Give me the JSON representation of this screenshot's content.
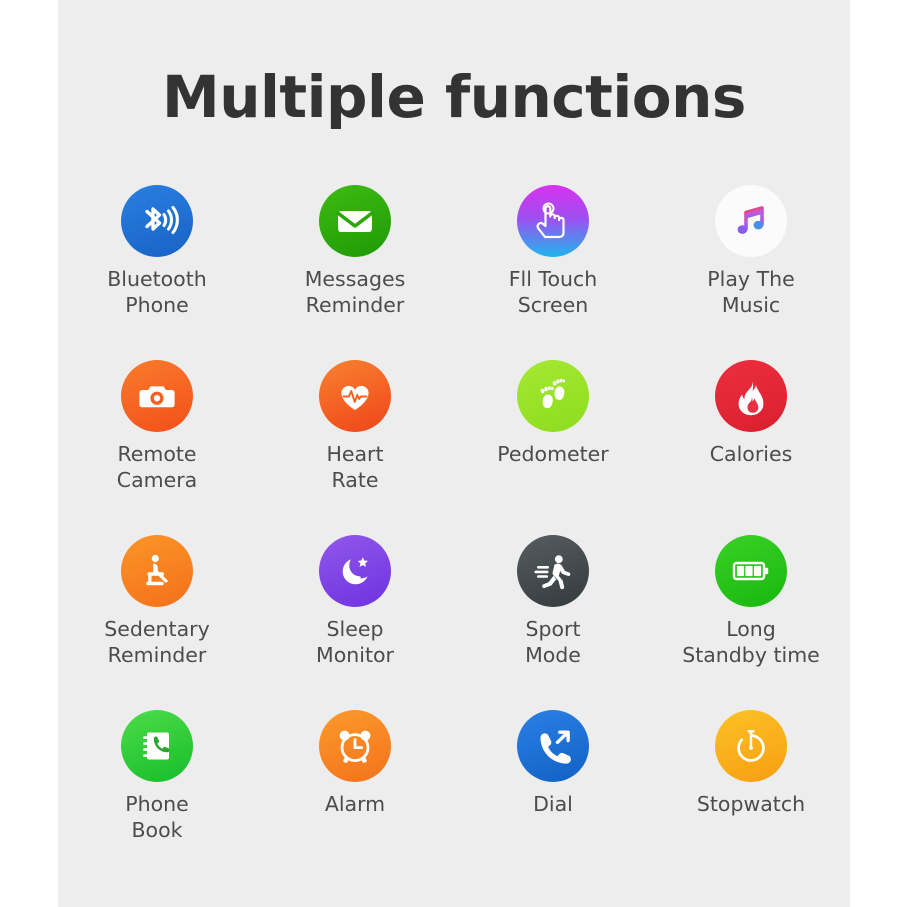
{
  "page": {
    "title": "Multiple functions",
    "background_color": "#ffffff",
    "panel_color": "#ededed",
    "title_color": "#333333",
    "label_color": "#4c4c4c"
  },
  "features": [
    {
      "label": "Bluetooth\nPhone",
      "icon": "bluetooth-icon",
      "accent": "#1862c6"
    },
    {
      "label": "Messages\nReminder",
      "icon": "envelope-icon",
      "accent": "#1f9a05"
    },
    {
      "label": "Fll Touch\nScreen",
      "icon": "touch-hand-icon",
      "accent": "#a04ef0"
    },
    {
      "label": "Play The\nMusic",
      "icon": "music-note-icon",
      "accent": "#f5385c"
    },
    {
      "label": "Remote\nCamera",
      "icon": "camera-icon",
      "accent": "#f24f19"
    },
    {
      "label": "Heart\nRate",
      "icon": "heart-pulse-icon",
      "accent": "#f0441a"
    },
    {
      "label": "Pedometer",
      "icon": "footprints-icon",
      "accent": "#8ddc1f"
    },
    {
      "label": "Calories",
      "icon": "flame-icon",
      "accent": "#d91f2e"
    },
    {
      "label": "Sedentary\nReminder",
      "icon": "seated-person-icon",
      "accent": "#f4701b"
    },
    {
      "label": "Sleep\nMonitor",
      "icon": "moon-star-icon",
      "accent": "#6f32e0"
    },
    {
      "label": "Sport\nMode",
      "icon": "running-person-icon",
      "accent": "#343b3e"
    },
    {
      "label": "Long\nStandby time",
      "icon": "battery-full-icon",
      "accent": "#18b80c"
    },
    {
      "label": "Phone\nBook",
      "icon": "phone-book-icon",
      "accent": "#17bd2a"
    },
    {
      "label": "Alarm",
      "icon": "alarm-clock-icon",
      "accent": "#f4721c"
    },
    {
      "label": "Dial",
      "icon": "phone-outgoing-icon",
      "accent": "#1261c4"
    },
    {
      "label": "Stopwatch",
      "icon": "stopwatch-icon",
      "accent": "#f79e10"
    }
  ]
}
